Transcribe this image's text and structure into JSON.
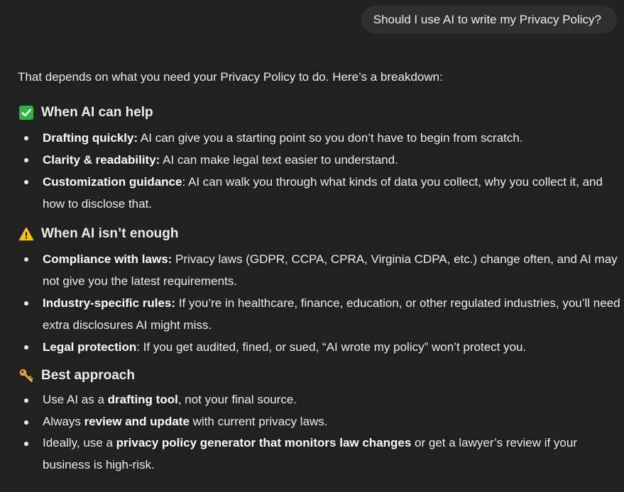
{
  "user_message": "Should I use AI to write my Privacy Policy?",
  "assistant": {
    "intro": "That depends on what you need your Privacy Policy to do. Here’s a breakdown:",
    "sections": [
      {
        "icon": "check-mark-button-icon",
        "title": "When AI can help",
        "items": [
          {
            "bold": "Drafting quickly:",
            "text": " AI can give you a starting point so you don’t have to begin from scratch."
          },
          {
            "bold": "Clarity & readability:",
            "text": " AI can make legal text easier to understand."
          },
          {
            "bold": "Customization guidance",
            "text": ": AI can walk you through what kinds of data you collect, why you collect it, and how to disclose that."
          }
        ]
      },
      {
        "icon": "warning-icon",
        "title": "When AI isn’t enough",
        "items": [
          {
            "bold": "Compliance with laws:",
            "text": " Privacy laws (GDPR, CCPA, CPRA, Virginia CDPA, etc.) change often, and AI may not give you the latest requirements."
          },
          {
            "bold": "Industry-specific rules:",
            "text": " If you’re in healthcare, finance, education, or other regulated industries, you’ll need extra disclosures AI might miss."
          },
          {
            "bold": "Legal protection",
            "text": ": If you get audited, fined, or sued, “AI wrote my policy” won’t protect you."
          }
        ]
      },
      {
        "icon": "key-icon",
        "title": "Best approach",
        "items": [
          {
            "pre": "Use AI as a ",
            "bold": "drafting tool",
            "post": ", not your final source."
          },
          {
            "pre": "Always ",
            "bold": "review and update",
            "post": " with current privacy laws."
          },
          {
            "pre": "Ideally, use a ",
            "bold": "privacy policy generator that monitors law changes",
            "post": " or get a lawyer’s review if your business is high-risk."
          }
        ]
      }
    ]
  },
  "colors": {
    "background": "#212121",
    "user_bubble": "#303030",
    "text": "#ececec",
    "check_green": "#2fb344",
    "warning_yellow": "#f5c211",
    "key_gold": "#e8a33d"
  }
}
